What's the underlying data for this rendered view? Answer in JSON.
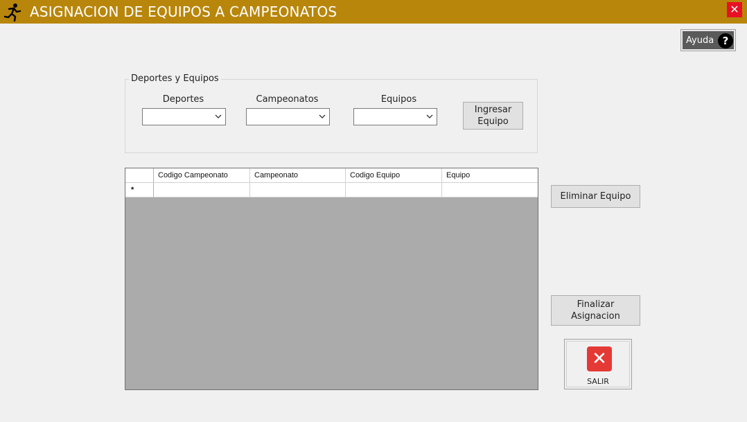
{
  "window": {
    "title": "ASIGNACION DE EQUIPOS A CAMPEONATOS",
    "close_glyph": "✕",
    "accent_color": "#b8860b"
  },
  "help": {
    "label": "Ayuda",
    "icon_glyph": "?"
  },
  "group": {
    "legend": "Deportes y Equipos",
    "fields": [
      {
        "label": "Deportes",
        "value": ""
      },
      {
        "label": "Campeonatos",
        "value": ""
      },
      {
        "label": "Equipos",
        "value": ""
      }
    ],
    "add_button": "Ingresar Equipo"
  },
  "grid": {
    "columns": [
      "Codigo Campeonato",
      "Campeonato",
      "Codigo Equipo",
      "Equipo"
    ],
    "new_row_marker": "*",
    "rows": []
  },
  "actions": {
    "delete_button": "Eliminar Equipo",
    "finish_button": "Finalizar Asignacion",
    "exit_label": "SALIR",
    "exit_glyph": "✕"
  }
}
